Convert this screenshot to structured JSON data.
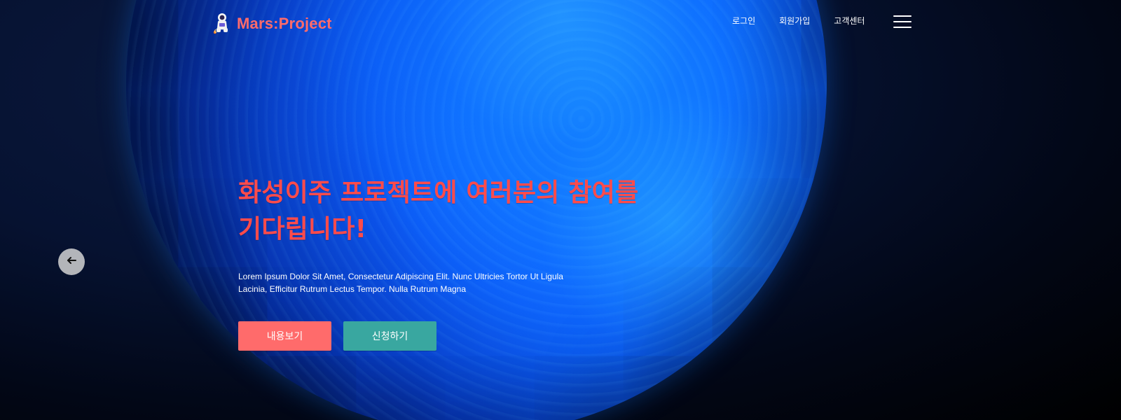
{
  "header": {
    "brand": {
      "name": "Mars:Project",
      "logo_icon": "astronaut-rocket-logo"
    },
    "nav": [
      {
        "label": "로그인"
      },
      {
        "label": "회원가입"
      },
      {
        "label": "고객센터"
      }
    ],
    "menu_icon": "hamburger-menu-icon"
  },
  "hero": {
    "headline_line1": "화성이주 프로젝트에 여러분의 참여를",
    "headline_line2": "기다립니다!",
    "description_line1": "Lorem Ipsum Dolor Sit Amet, Consectetur Adipiscing Elit. Nunc Ultricies Tortor Ut Ligula",
    "description_line2": "Lacinia, Efficitur Rutrum Lectus Tempor. Nulla Rutrum Magna",
    "buttons": {
      "primary": "내용보기",
      "secondary": "신청하기"
    },
    "carousel_prev_icon": "arrow-left-icon"
  },
  "colors": {
    "brand_coral": "#ff6b6b",
    "headline_red": "#ff4b4b",
    "teal": "#39a7a0",
    "planet_blue": "#1d78ff",
    "background": "#020716"
  }
}
